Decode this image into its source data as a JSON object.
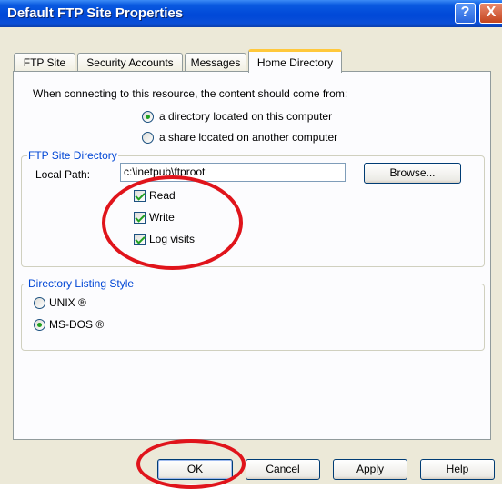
{
  "window": {
    "title": "Default FTP Site Properties",
    "help_button": "?",
    "close_button": "X"
  },
  "tabs": [
    {
      "label": "FTP Site",
      "active": false
    },
    {
      "label": "Security Accounts",
      "active": false
    },
    {
      "label": "Messages",
      "active": false
    },
    {
      "label": "Home Directory",
      "active": true
    }
  ],
  "content_source": {
    "prompt": "When connecting to this resource, the content should come from:",
    "options": [
      {
        "label": "a directory located on this computer",
        "selected": true
      },
      {
        "label": "a share located on another computer",
        "selected": false
      }
    ]
  },
  "site_directory": {
    "legend": "FTP Site Directory",
    "local_path_label": "Local Path:",
    "local_path_value": "c:\\inetpub\\ftproot",
    "browse_label": "Browse...",
    "permissions": [
      {
        "label": "Read",
        "checked": true
      },
      {
        "label": "Write",
        "checked": true
      },
      {
        "label": "Log visits",
        "checked": true
      }
    ]
  },
  "listing_style": {
    "legend": "Directory Listing Style",
    "options": [
      {
        "label": "UNIX ®",
        "selected": false
      },
      {
        "label": "MS-DOS ®",
        "selected": true
      }
    ]
  },
  "buttons": {
    "ok": "OK",
    "cancel": "Cancel",
    "apply": "Apply",
    "help": "Help"
  },
  "colors": {
    "title_bar": "#0048d8",
    "dialog_bg": "#ece9d8",
    "group_legend": "#0046d5",
    "annotation_ring": "#e0141b",
    "check_mark": "#21a121"
  }
}
